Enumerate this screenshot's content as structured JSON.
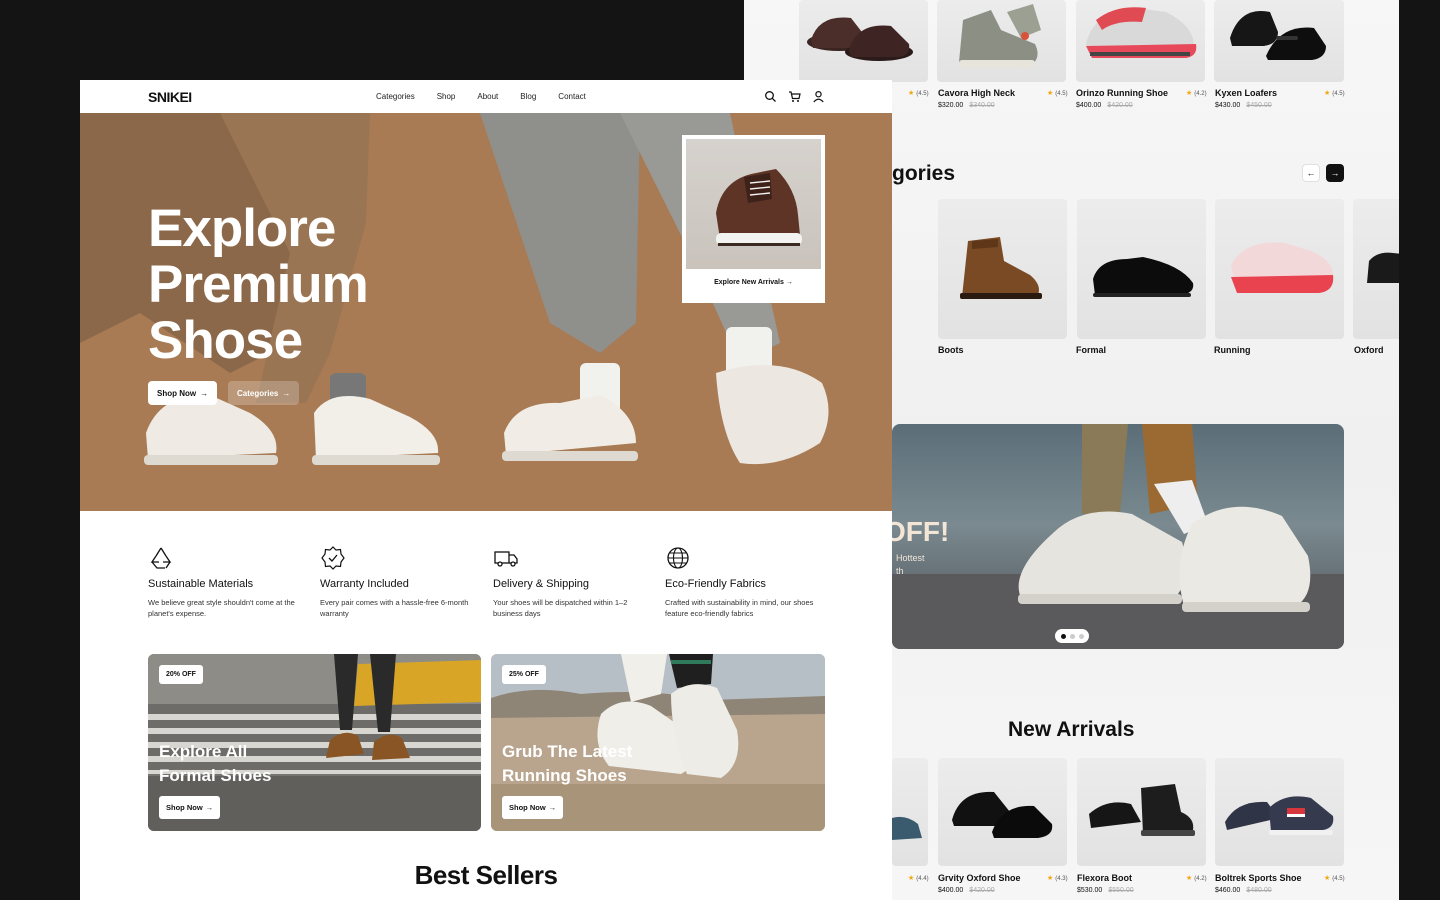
{
  "brand": {
    "logo": "SNIKEI"
  },
  "nav": {
    "menu": [
      "Categories",
      "Shop",
      "About",
      "Blog",
      "Contact"
    ],
    "icons": [
      "search-icon",
      "cart-icon",
      "user-icon"
    ]
  },
  "hero": {
    "title_lines": [
      "Explore",
      "Premium",
      "Shose"
    ],
    "shop_now": "Shop Now",
    "categories": "Categories",
    "arrival_card_label": "Explore New Arrivals"
  },
  "features": [
    {
      "icon": "recycle-icon",
      "title": "Sustainable Materials",
      "text": "We believe great style shouldn't come at the planet's expense."
    },
    {
      "icon": "badge-check-icon",
      "title": "Warranty Included",
      "text": "Every pair comes with a hassle-free 6-month warranty"
    },
    {
      "icon": "truck-icon",
      "title": "Delivery & Shipping",
      "text": "Your shoes will be dispatched within 1–2 business days"
    },
    {
      "icon": "globe-leaf-icon",
      "title": "Eco-Friendly Fabrics",
      "text": "Crafted with sustainability in mind, our shoes feature eco-friendly fabrics"
    }
  ],
  "promos": [
    {
      "badge": "20% OFF",
      "title_lines": [
        "Explore All",
        "Formal Shoes"
      ],
      "button": "Shop Now"
    },
    {
      "badge": "25% OFF",
      "title_lines": [
        "Grub The Latest",
        "Running Shoes"
      ],
      "button": "Shop Now"
    }
  ],
  "best_sellers_title": "Best Sellers",
  "back_page": {
    "top_products": [
      {
        "name": "",
        "rating": "(4.5)",
        "price": "",
        "old_price": ""
      },
      {
        "name": "Cavora High Neck",
        "rating": "(4.5)",
        "price": "$320.00",
        "old_price": "$340.00"
      },
      {
        "name": "Orinzo Running Shoe",
        "rating": "(4.2)",
        "price": "$400.00",
        "old_price": "$420.00"
      },
      {
        "name": "Kyxen Loafers",
        "rating": "(4.5)",
        "price": "$430.00",
        "old_price": "$450.00"
      }
    ],
    "categories_title_fragment": "gories",
    "categories": [
      "Boots",
      "Formal",
      "Running",
      "Oxford"
    ],
    "banner": {
      "off_fragment": "OFF!",
      "sub_lines": [
        "Hottest",
        "th"
      ]
    },
    "new_arrivals_title": "New Arrivals",
    "new_arrivals": [
      {
        "name": "",
        "rating": "(4.4)",
        "price": "",
        "old_price": ""
      },
      {
        "name": "Grvity Oxford Shoe",
        "rating": "(4.3)",
        "price": "$400.00",
        "old_price": "$420.00"
      },
      {
        "name": "Flexora Boot",
        "rating": "(4.2)",
        "price": "$530.00",
        "old_price": "$550.00"
      },
      {
        "name": "Boltrek Sports Shoe",
        "rating": "(4.5)",
        "price": "$460.00",
        "old_price": "$480.00"
      }
    ]
  },
  "colors": {
    "hero_bg": "#a57a55",
    "accent_star": "#f2a80d",
    "dark": "#111111"
  }
}
